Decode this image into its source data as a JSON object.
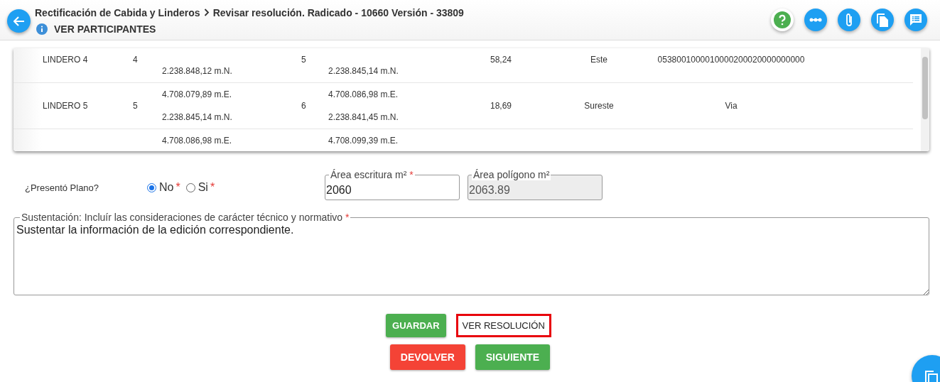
{
  "header": {
    "breadcrumb": "Rectificación de Cabida y Linderos",
    "title": "Revisar resolución. Radicado - 10660 Versión - 33809",
    "participants_link": "VER PARTICIPANTES"
  },
  "table": {
    "rows": [
      {
        "name": "LINDERO 4",
        "from_point": "4",
        "from_north": "2.238.848,12 m.N.",
        "to_point": "5",
        "to_north": "2.238.845,14 m.N.",
        "distance": "58,24",
        "direction": "Este",
        "neighbor": "0538001000010000200020000000000"
      },
      {
        "name": "LINDERO 5",
        "from_point": "5",
        "from_east": "4.708.079,89 m.E.",
        "from_north": "2.238.845,14 m.N.",
        "to_point": "6",
        "to_east": "4.708.086,98 m.E.",
        "to_north": "2.238.841,45 m.N.",
        "distance": "18,69",
        "direction": "Sureste",
        "neighbor": "Via"
      },
      {
        "from_east": "4.708.086,98 m.E.",
        "to_east": "4.708.099,39 m.E."
      }
    ]
  },
  "form": {
    "plano": {
      "label": "¿Presentó Plano?",
      "options": [
        {
          "label": "No",
          "selected": true,
          "required_mark": "*"
        },
        {
          "label": "Si",
          "selected": false,
          "required_mark": "*"
        }
      ]
    },
    "area_escritura": {
      "label": "Área escritura m²",
      "required_mark": "*",
      "value": "2060",
      "disabled": false
    },
    "area_poligono": {
      "label": "Área polígono m²",
      "value": "2063.89",
      "disabled": true
    },
    "sustentacion": {
      "label": "Sustentación: Incluír las consideraciones de carácter técnico y normativo",
      "required_mark": "*",
      "value": "Sustentar la información de la edición correspondiente."
    }
  },
  "button_rows": [
    [
      {
        "label": "GUARDAR",
        "kind": "save"
      },
      {
        "label": "VER RESOLUCIÓN",
        "kind": "highlighted"
      }
    ],
    [
      {
        "label": "DEVOLVER",
        "kind": "danger"
      },
      {
        "label": "SIGUIENTE",
        "kind": "primary"
      }
    ]
  ]
}
